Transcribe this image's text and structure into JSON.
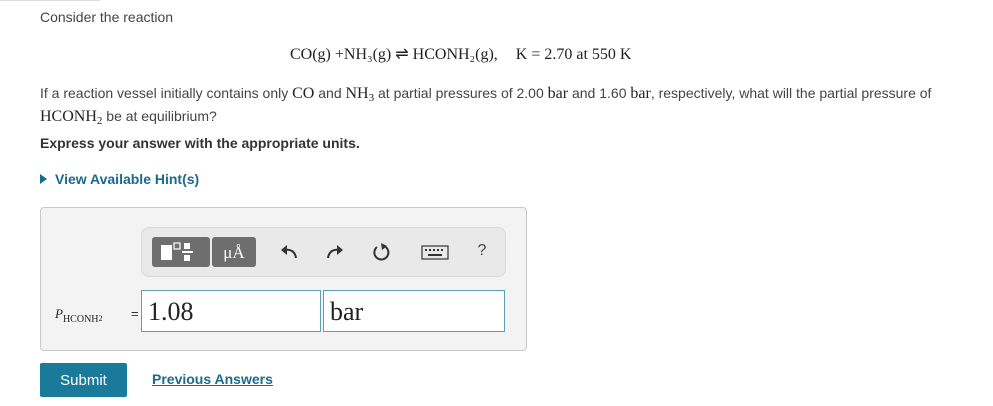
{
  "intro": "Consider the reaction",
  "equation": {
    "reaction": "CO(g) +NH₃(g) ⇌ HCONH₂(g),",
    "constant": "K = 2.70 at 550 K"
  },
  "question": {
    "part1": "If a reaction vessel initially contains only ",
    "co": "CO",
    "part2": " and ",
    "nh3": "NH",
    "nh3_sub": "3",
    "part3": " at partial pressures of 2.00 ",
    "unit_a": "bar",
    "part4": " and 1.60 ",
    "unit_b": "bar",
    "part5": ", respectively, what will the partial pressure of ",
    "hconh": "HCONH",
    "hconh_sub": "2",
    "part6": " be at equilibrium?"
  },
  "instruction": "Express your answer with the appropriate units.",
  "hints_label": "View Available Hint(s)",
  "toolbar": {
    "units_label": "μÅ",
    "help_label": "?"
  },
  "answer": {
    "var_main": "P",
    "var_sub": "HCONH",
    "var_sub2": "2",
    "eq": "=",
    "value": "1.08",
    "unit": "bar"
  },
  "buttons": {
    "submit": "Submit",
    "previous": "Previous Answers"
  }
}
